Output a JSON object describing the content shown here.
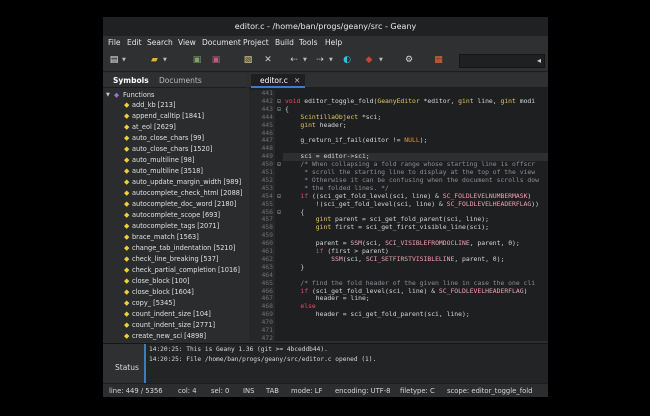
{
  "window": {
    "title": "editor.c - /home/ban/progs/geany/src - Geany"
  },
  "menu": [
    "File",
    "Edit",
    "Search",
    "View",
    "Document",
    "Project",
    "Build",
    "Tools",
    "Help"
  ],
  "toolbar": {
    "icons": [
      "new-file-icon",
      "open-file-icon",
      "save-icon",
      "save-all-icon",
      "revert-icon",
      "close-icon",
      "back-icon",
      "forward-icon",
      "compile-icon",
      "build-icon",
      "run-icon",
      "color-chooser-icon"
    ],
    "search_placeholder": ""
  },
  "sidebar": {
    "tabs": [
      "Symbols",
      "Documents"
    ],
    "root": "Functions",
    "items": [
      "add_kb [213]",
      "append_calltip [1841]",
      "at_eol [2629]",
      "auto_close_chars [99]",
      "auto_close_chars [1520]",
      "auto_multiline [98]",
      "auto_multiline [3518]",
      "auto_update_margin_width [989]",
      "autocomplete_check_html [2088]",
      "autocomplete_doc_word [2180]",
      "autocomplete_scope [693]",
      "autocomplete_tags [2071]",
      "brace_match [1563]",
      "change_tab_indentation [5210]",
      "check_line_breaking [537]",
      "check_partial_completion [1016]",
      "close_block [100]",
      "close_block [1604]",
      "copy_ [5345]",
      "count_indent_size [104]",
      "count_indent_size [2771]",
      "create_new_sci [4898]"
    ]
  },
  "editor": {
    "tab_label": "editor.c",
    "tab_close": "✕",
    "line_numbers": [
      "441",
      "442",
      "443",
      "444",
      "445",
      "446",
      "447",
      "448",
      "449",
      "450",
      "451",
      "452",
      "453",
      "454",
      "455",
      "456",
      "457",
      "458",
      "459",
      "460",
      "461",
      "462",
      "463",
      "464",
      "465",
      "466",
      "467",
      "468",
      "469",
      "470",
      "471",
      "472"
    ],
    "lines": [
      "",
      "void editor_toggle_fold(GeanyEditor *editor, gint line, gint modi",
      "{",
      "    ScintillaObject *sci;",
      "    gint header;",
      "",
      "    g_return_if_fail(editor != NULL);",
      "",
      "    sci = editor->sci;",
      "    /* When collapsing a fold range whose starting line is offscr",
      "     * scroll the starting line to display at the top of the view",
      "     * Otherwise it can be confusing when the document scrolls dow",
      "     * the folded lines. */",
      "    if ((sci_get_fold_level(sci, line) & SC_FOLDLEVELNUMBERMASK)",
      "        !(sci_get_fold_level(sci, line) & SC_FOLDLEVELHEADERFLAG))",
      "    {",
      "        gint parent = sci_get_fold_parent(sci, line);",
      "        gint first = sci_get_first_visible_line(sci);",
      "",
      "        parent = SSM(sci, SCI_VISIBLEFROMDOCLINE, parent, 0);",
      "        if (first > parent)",
      "            SSM(sci, SCI_SETFIRSTVISIBLELINE, parent, 0);",
      "    }",
      "",
      "    /* find the fold header of the given line in case the one cli",
      "    if (sci_get_fold_level(sci, line) & SC_FOLDLEVELHEADERFLAG)",
      "        header = line;",
      "    else",
      "        header = sci_get_fold_parent(sci, line);",
      "",
      "",
      ""
    ]
  },
  "messages": {
    "tab": "Status",
    "lines": [
      "14:20:25: This is Geany 1.36 (git >= 4bceddb44).",
      "14:20:25: File /home/ban/progs/geany/src/editor.c opened (1)."
    ]
  },
  "status": {
    "line": "line: 449 / 5356",
    "col": "col: 4",
    "sel": "sel: 0",
    "ins": "INS",
    "tab": "TAB",
    "mode": "mode: LF",
    "encoding": "encoding: UTF-8",
    "filetype": "filetype: C",
    "scope": "scope: editor_toggle_fold"
  }
}
